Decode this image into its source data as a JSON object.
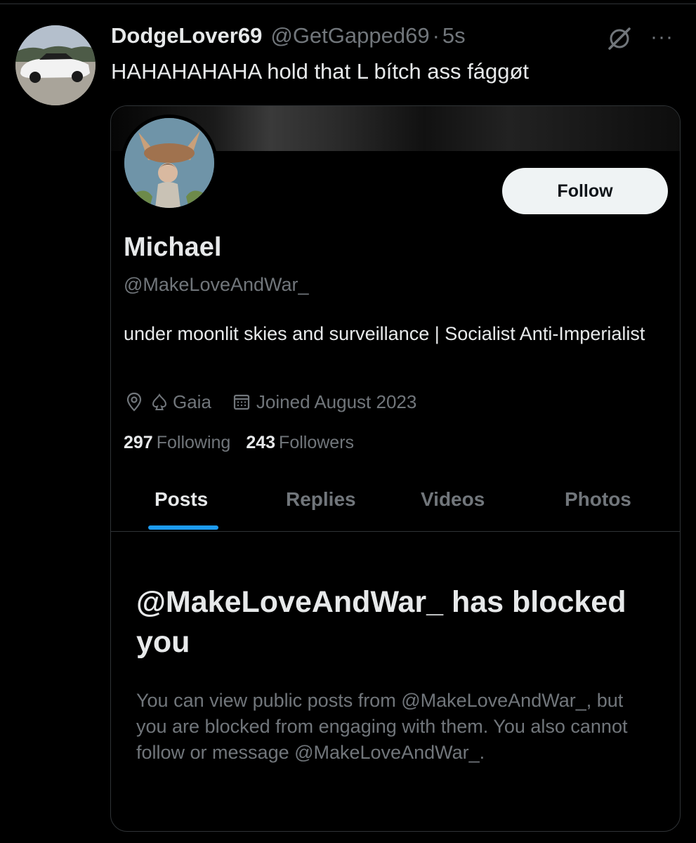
{
  "tweet": {
    "author_name": "DodgeLover69",
    "author_handle": "@GetGapped69",
    "separator": "·",
    "time": "5s",
    "text": "HAHAHAHAHA hold that L bítch ass fággøt",
    "more_glyph": "···"
  },
  "profile_card": {
    "follow_label": "Follow",
    "name": "Michael",
    "handle": "@MakeLoveAndWar_",
    "bio": "under moonlit skies and surveillance | Socialist Anti-Imperialist",
    "location": "Gaia",
    "joined": "Joined August 2023",
    "following_count": "297",
    "following_label": "Following",
    "followers_count": "243",
    "followers_label": "Followers",
    "tabs": [
      {
        "label": "Posts",
        "active": true
      },
      {
        "label": "Replies",
        "active": false
      },
      {
        "label": "Videos",
        "active": false
      },
      {
        "label": "Photos",
        "active": false
      }
    ],
    "blocked_title": "@MakeLoveAndWar_ has blocked you",
    "blocked_body": "You can view public posts from @MakeLoveAndWar_, but you are blocked from engaging with them. You also cannot follow or message @MakeLoveAndWar_."
  },
  "icons": {
    "grok": "grok-icon",
    "more": "more-icon",
    "location": "location-pin-icon",
    "spade": "spade-icon",
    "calendar": "calendar-icon"
  },
  "colors": {
    "background": "#000000",
    "text_primary": "#e7e9ea",
    "text_secondary": "#71767b",
    "accent": "#1d9bf0",
    "border": "#2f3336",
    "follow_bg": "#eff3f4"
  }
}
